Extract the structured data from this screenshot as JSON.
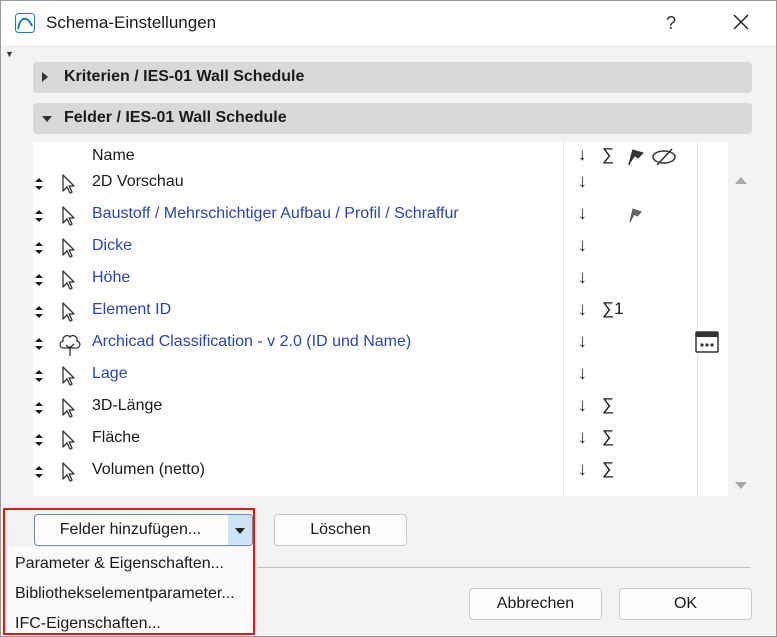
{
  "window": {
    "title": "Schema-Einstellungen",
    "help_label": "?"
  },
  "sections": [
    {
      "label": "Kriterien / IES-01  Wall Schedule",
      "expanded": false
    },
    {
      "label": "Felder / IES-01  Wall Schedule",
      "expanded": true
    }
  ],
  "table": {
    "header": {
      "name": "Name",
      "sort_icon": "↓",
      "sum_icon": "∑"
    },
    "rows": [
      {
        "label": "2D Vorschau",
        "icon": "pointer-icon",
        "sort": "↓",
        "sum": "",
        "flag": false,
        "more": false,
        "linked": false
      },
      {
        "label": "Baustoff / Mehrschichtiger Aufbau / Profil / Schraffur",
        "icon": "pointer-icon",
        "sort": "↓",
        "sum": "",
        "flag": true,
        "more": false,
        "linked": true
      },
      {
        "label": "Dicke",
        "icon": "pointer-icon",
        "sort": "↓",
        "sum": "",
        "flag": false,
        "more": false,
        "linked": true
      },
      {
        "label": "Höhe",
        "icon": "pointer-icon",
        "sort": "↓",
        "sum": "",
        "flag": false,
        "more": false,
        "linked": true
      },
      {
        "label": "Element ID",
        "icon": "pointer-icon",
        "sort": "↓",
        "sum": "∑1",
        "flag": false,
        "more": false,
        "linked": true
      },
      {
        "label": "Archicad Classification - v 2.0 (ID und Name)",
        "icon": "classification-tree-icon",
        "sort": "↓",
        "sum": "",
        "flag": false,
        "more": true,
        "linked": true
      },
      {
        "label": "Lage",
        "icon": "pointer-icon",
        "sort": "↓",
        "sum": "",
        "flag": false,
        "more": false,
        "linked": true
      },
      {
        "label": "3D-Länge",
        "icon": "pointer-icon",
        "sort": "↓",
        "sum": "∑",
        "flag": false,
        "more": false,
        "linked": false
      },
      {
        "label": "Fläche",
        "icon": "pointer-icon",
        "sort": "↓",
        "sum": "∑",
        "flag": false,
        "more": false,
        "linked": false
      },
      {
        "label": "Volumen (netto)",
        "icon": "pointer-icon",
        "sort": "↓",
        "sum": "∑",
        "flag": false,
        "more": false,
        "linked": false
      }
    ]
  },
  "buttons": {
    "add_fields": "Felder hinzufügen...",
    "delete": "Löschen",
    "cancel": "Abbrechen",
    "ok": "OK"
  },
  "dropdown": {
    "items": [
      "Parameter & Eigenschaften...",
      "Bibliothekselementparameter...",
      "IFC-Eigenschaften..."
    ]
  },
  "colors": {
    "link": "#2b45b0",
    "highlight": "#e01818",
    "accent": "#cfe3f6"
  }
}
